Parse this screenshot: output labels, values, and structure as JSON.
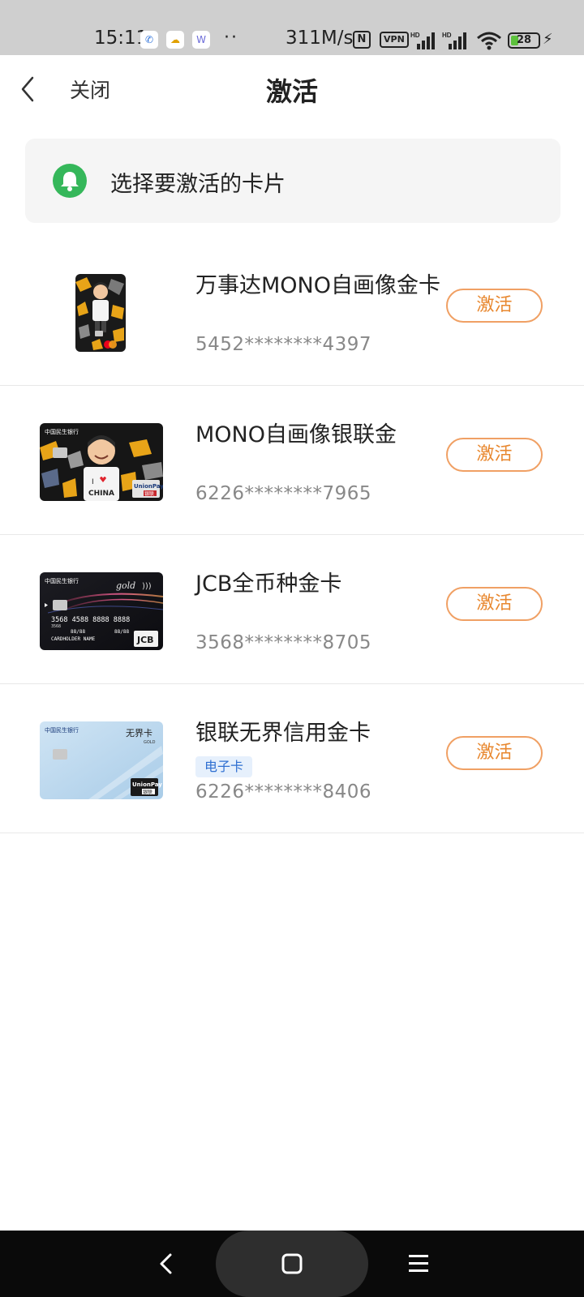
{
  "status_bar": {
    "time": "15:11",
    "apps": [
      {
        "icon": "telecom-icon",
        "glyph": "✆"
      },
      {
        "icon": "weather-icon",
        "glyph": "☁"
      },
      {
        "icon": "app-w-icon",
        "glyph": "W"
      }
    ],
    "dots": "··",
    "speed": "311M/s",
    "nfc": "N",
    "vpn": "VPN",
    "battery": "28",
    "battery_level": 0.28,
    "battery_color": "#5cc13c"
  },
  "header": {
    "back_icon": "chevron-left-icon",
    "close_label": "关闭",
    "title": "激活"
  },
  "notice": {
    "icon": "bell-icon",
    "icon_color": "#35b75a",
    "text": "选择要激活的卡片"
  },
  "cards": [
    {
      "name": "万事达MONO自画像金卡",
      "number": "5452********4397",
      "button": "激活",
      "badge": null
    },
    {
      "name": "MONO自画像银联金",
      "number": "6226********7965",
      "button": "激活",
      "badge": null
    },
    {
      "name": "JCB全币种金卡",
      "number": "3568********8705",
      "button": "激活",
      "badge": null
    },
    {
      "name": "银联无界信用金卡",
      "number": "6226********8406",
      "button": "激活",
      "badge": "电子卡"
    }
  ],
  "card_art": {
    "bank_name": "中国民生银行",
    "i_love": "I",
    "china": "CHINA",
    "unionpay": "UnionPay",
    "unionpay_cn": "银联",
    "gold": "gold",
    "jcb_number": "3568 4588 8888 8888",
    "jcb_small": "3568",
    "validity": "88/88",
    "holder": "CARDHOLDER NAME",
    "jcb": "JCB",
    "wujie": "无界卡",
    "gold_caps": "GOLD"
  },
  "colors": {
    "accent": "#e8872e",
    "accent_border": "#f0a064",
    "badge_bg": "#e6f0fc",
    "badge_text": "#2f6fd1"
  },
  "nav_bar": {
    "back_icon": "nav-back-icon",
    "home_icon": "nav-home-icon",
    "menu_icon": "nav-menu-icon"
  }
}
